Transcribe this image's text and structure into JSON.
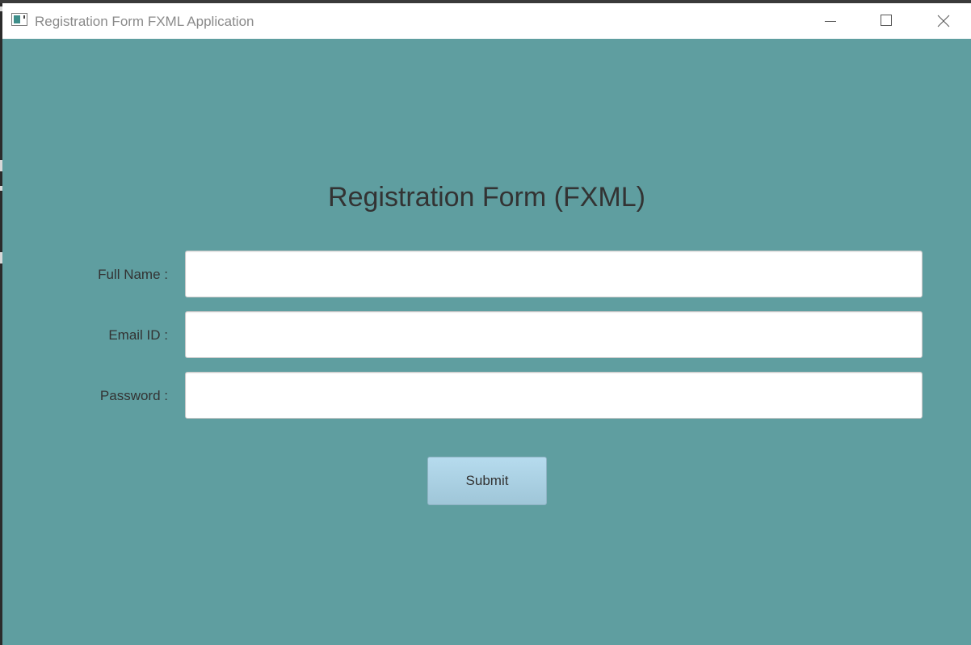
{
  "window": {
    "title": "Registration Form FXML Application"
  },
  "form": {
    "heading": "Registration Form (FXML)",
    "fields": [
      {
        "label": "Full Name :",
        "value": "",
        "placeholder": ""
      },
      {
        "label": "Email ID :",
        "value": "",
        "placeholder": ""
      },
      {
        "label": "Password :",
        "value": "",
        "placeholder": ""
      }
    ],
    "submit_label": "Submit"
  },
  "icons": {
    "app": "java-app-icon",
    "minimize": "minimize-icon",
    "maximize": "maximize-icon",
    "close": "close-icon"
  },
  "colors": {
    "background": "#5f9ea0",
    "titlebar": "#ffffff",
    "button": "#a9d0e3"
  }
}
